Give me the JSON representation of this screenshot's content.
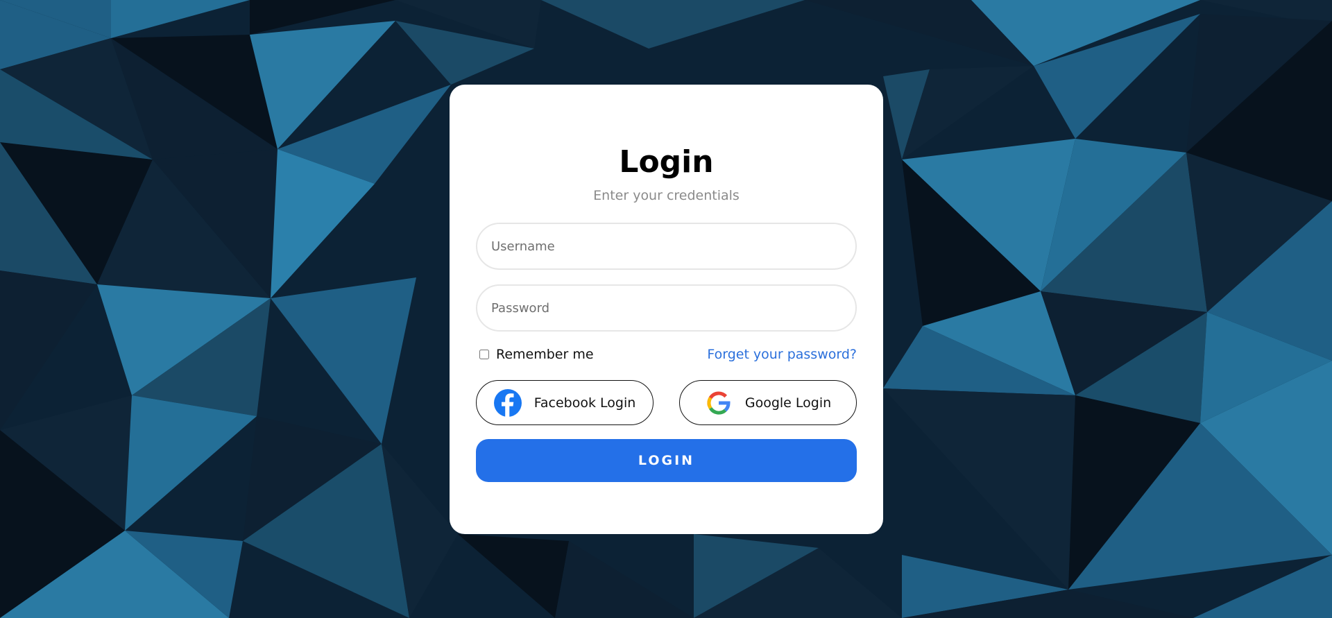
{
  "page": {
    "title": "Login",
    "subtitle": "Enter your credentials"
  },
  "form": {
    "username": {
      "value": "",
      "placeholder": "Username"
    },
    "password": {
      "value": "",
      "placeholder": "Password"
    },
    "remember_label": "Remember me",
    "remember_checked": false,
    "forgot_link": "Forget your password?"
  },
  "social": {
    "facebook_label": "Facebook Login",
    "facebook_icon": "facebook-icon",
    "google_label": "Google Login",
    "google_icon": "google-icon"
  },
  "actions": {
    "login_label": "LOGIN"
  },
  "colors": {
    "primary": "#2470e8",
    "link": "#2a6fdb",
    "facebook": "#1877f2",
    "background_dark": "#0c2235",
    "background_light": "#2a7aa3"
  }
}
